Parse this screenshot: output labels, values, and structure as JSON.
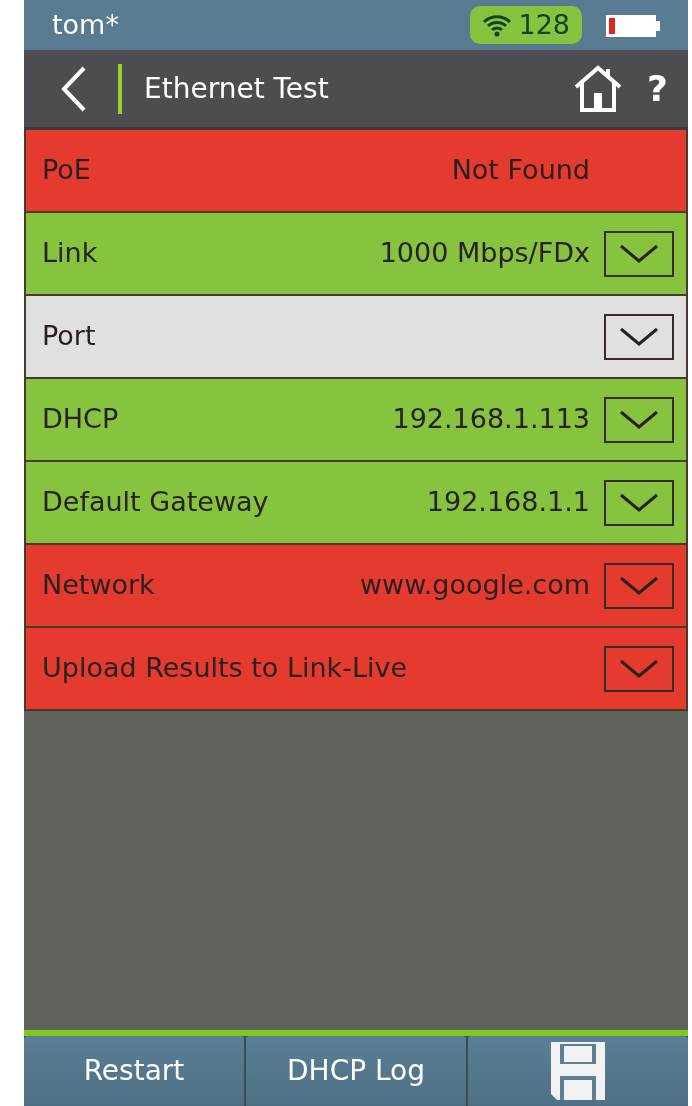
{
  "status_bar": {
    "user": "tom*",
    "wifi_count": "128"
  },
  "header": {
    "title": "Ethernet Test",
    "help": "?"
  },
  "tests": [
    {
      "label": "PoE",
      "value": "Not Found",
      "color": "#e53b2e",
      "expandable": false
    },
    {
      "label": "Link",
      "value": "1000 Mbps/FDx",
      "color": "#86c440",
      "expandable": true
    },
    {
      "label": "Port",
      "color": "#e0e0e0",
      "expandable": true
    },
    {
      "label": "DHCP",
      "value": "192.168.1.113",
      "color": "#86c440",
      "expandable": true
    },
    {
      "label": "Default Gateway",
      "value": "192.168.1.1",
      "color": "#86c440",
      "expandable": true
    },
    {
      "label": "Network",
      "value": "www.google.com",
      "color": "#e53b2e",
      "expandable": true
    },
    {
      "label": "Upload Results to Link-Live",
      "color": "#e53b2e",
      "expandable": true
    }
  ],
  "footer_buttons": [
    {
      "kind": "text",
      "label": "Restart"
    },
    {
      "kind": "text",
      "label": "DHCP Log"
    },
    {
      "kind": "save"
    }
  ]
}
